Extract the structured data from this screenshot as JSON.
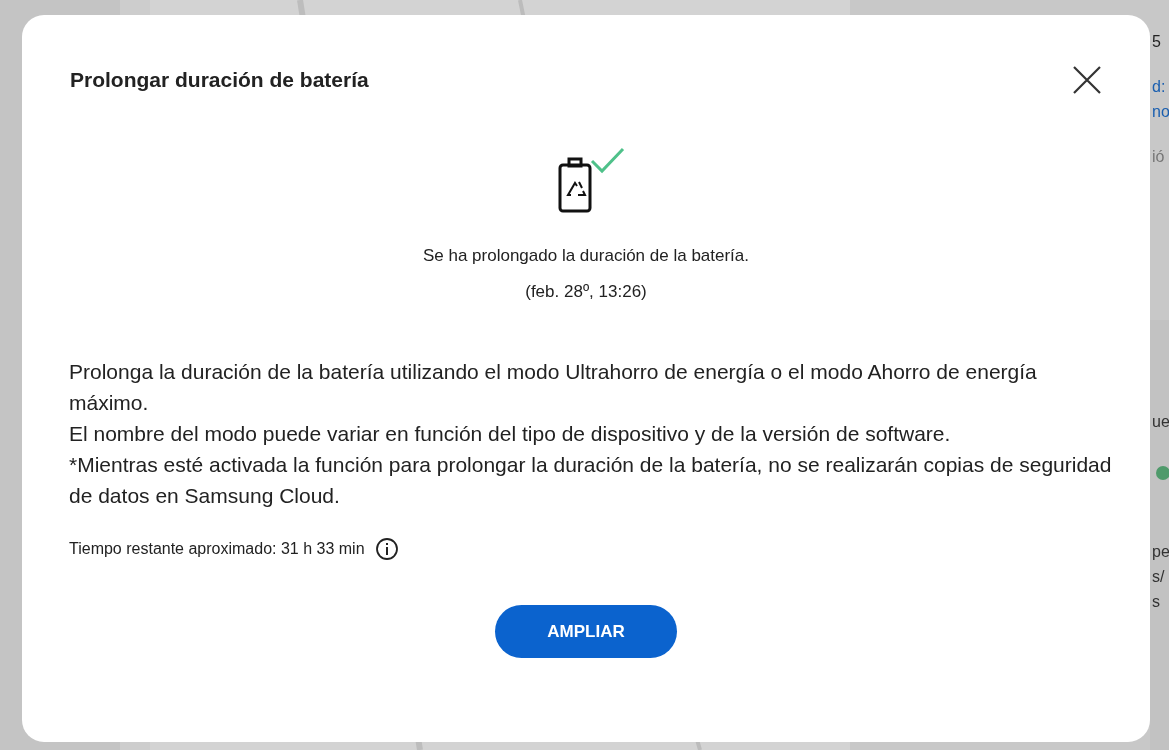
{
  "background": {
    "kind": "picture",
    "edge_texts": [
      "5",
      "d:",
      "no",
      "ió",
      "ue",
      "pe",
      "s/",
      "s"
    ]
  },
  "dialog": {
    "title": "Prolongar duración de batería",
    "status": "Se ha prolongado la duración de la batería.",
    "timestamp": "(feb. 28º, 13:26)",
    "paragraphs": [
      "Prolonga la duración de la batería utilizando el modo Ultrahorro de energía o el modo Ahorro de energía máximo.",
      "El nombre del modo puede variar en función del tipo de dispositivo y de la versión de software.",
      "*Mientras esté activada la función para prolongar la duración de la batería, no se realizarán copias de seguridad de datos en Samsung Cloud."
    ],
    "remaining": "Tiempo restante aproximado: 31 h 33 min",
    "button": "AMPLIAR"
  }
}
